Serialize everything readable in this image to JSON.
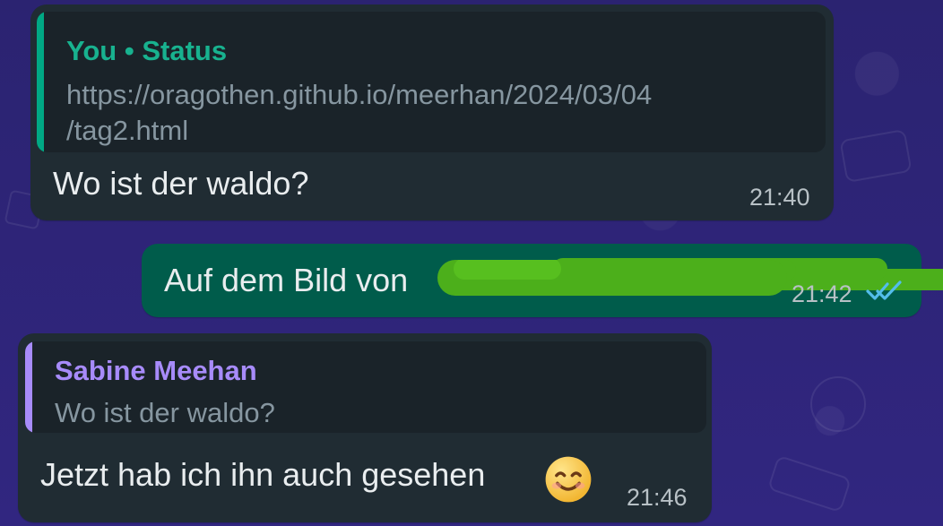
{
  "messages": [
    {
      "direction": "incoming",
      "quote": {
        "sender": "You • Status",
        "text": "https://oragothen.github.io/meerhan/2024/03/04\n/tag2.html",
        "bar_color": "#00a884"
      },
      "text": "Wo ist der waldo?",
      "time": "21:40"
    },
    {
      "direction": "outgoing",
      "text": "Auf dem Bild von",
      "time": "21:42",
      "status_icon": "double-check-icon",
      "redaction_color": "#4caf1b"
    },
    {
      "direction": "incoming",
      "quote": {
        "sender": "Sabine Meehan",
        "text": "Wo ist der waldo?",
        "bar_color": "#a78bfa"
      },
      "text": "Jetzt hab ich ihn auch gesehen",
      "emoji": "smiling-face-icon",
      "time": "21:46"
    }
  ],
  "theme": {
    "incoming_bubble": "#202c33",
    "outgoing_bubble": "#005c4b",
    "wallpaper": "#312680",
    "text": "#e9edef",
    "meta_text": "#b8c1c6"
  }
}
